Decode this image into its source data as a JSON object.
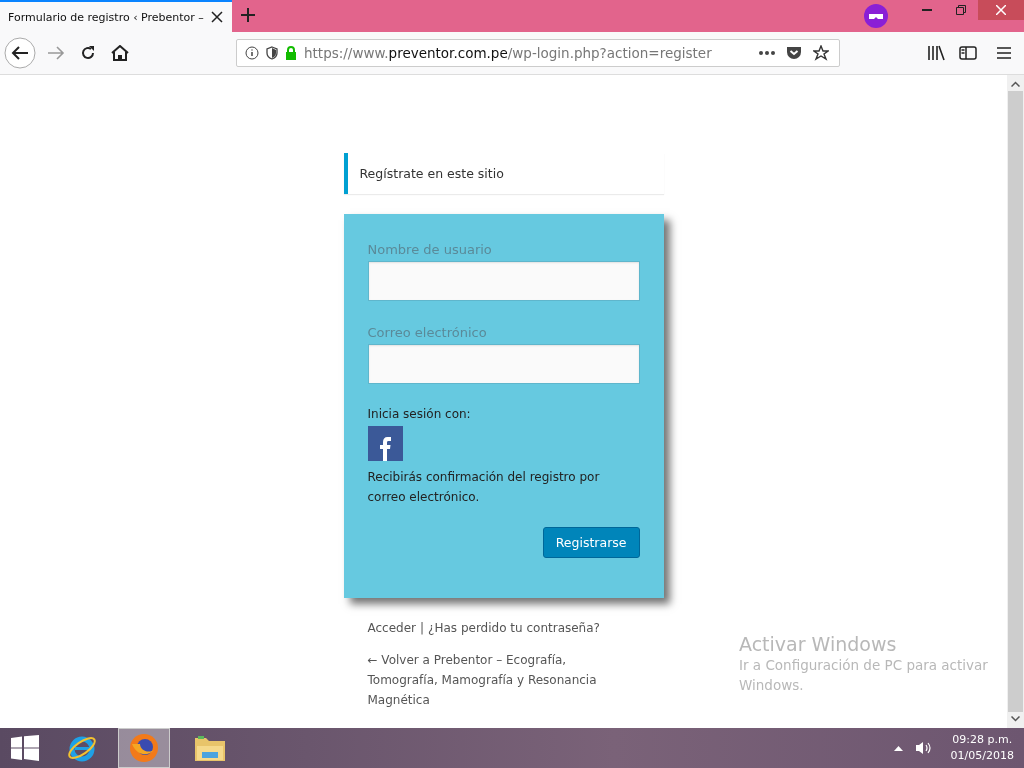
{
  "browser": {
    "tab": {
      "title": "Formulario de registro ‹ Prebentor –",
      "selected": true
    },
    "url": {
      "prefix": "https://www.",
      "domain": "preventor.com.pe",
      "path": "/wp-login.php?action=register"
    },
    "secure": true
  },
  "notice": "Regístrate en este sitio",
  "form": {
    "fields": [
      {
        "label": "Nombre de usuario"
      },
      {
        "label": "Correo electrónico"
      }
    ],
    "social_label": "Inicia sesión con:",
    "message": "Recibirás confirmación del registro por correo electrónico.",
    "submit": "Registrarse"
  },
  "links": [
    "Acceder",
    "¿Has perdido tu contraseña?"
  ],
  "separator": "|",
  "back_link": "← Volver a Prebentor – Ecografía, Tomografía, Mamografía y Resonancia Magnética",
  "activation": {
    "title": "Activar Windows",
    "text": "Ir a Configuración de PC para activar Windows."
  },
  "taskbar": {
    "apps": [
      {
        "kind": "start",
        "selected": false
      },
      {
        "kind": "ie",
        "selected": false
      },
      {
        "kind": "firefox",
        "selected": true
      },
      {
        "kind": "explorer",
        "selected": false
      }
    ],
    "time": "09:28 p.m.",
    "date": "01/05/2018"
  }
}
